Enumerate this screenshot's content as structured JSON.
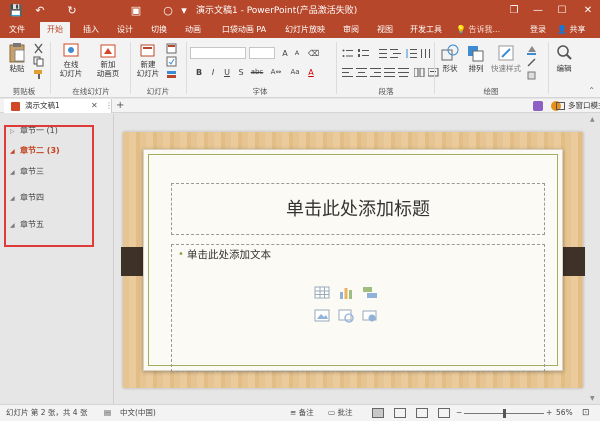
{
  "window": {
    "title": "演示文稿1 - PowerPoint(产品激活失败)",
    "controls": {
      "restore": "❐",
      "minimize": "—",
      "maximize": "☐",
      "close": "✕"
    }
  },
  "quick_access": {
    "save": "💾",
    "undo": "↶",
    "redo": "↻",
    "slideshow": "▣",
    "shape": "○",
    "customize": "▾"
  },
  "tabs": [
    "文件",
    "开始",
    "插入",
    "设计",
    "切换",
    "动画",
    "口袋动画 PA",
    "幻灯片放映",
    "审阅",
    "视图",
    "开发工具"
  ],
  "active_tab": "开始",
  "tell_me": "告诉我...",
  "login": "登录",
  "share": "共享",
  "ribbon": {
    "paste": "粘贴",
    "online_slides": "在线\n幻灯片",
    "new_animation_page": "新加\n动画页",
    "new_slide": "新建\n幻灯片",
    "shape": "形状",
    "arrange": "排列",
    "quick_styles": "快速样式",
    "edit": "编辑",
    "groups": {
      "clipboard": "剪贴板",
      "online_slides": "在线幻灯片",
      "slides": "幻灯片",
      "font": "字体",
      "paragraph": "段落",
      "drawing": "绘图"
    },
    "font_buttons": [
      "B",
      "I",
      "U",
      "S",
      "abc",
      "A⇔",
      "Aa",
      "A",
      "A"
    ],
    "collapse": "⌃"
  },
  "doc_tab": {
    "name": "演示文稿1",
    "close": "✕",
    "more": "⋮",
    "new": "+"
  },
  "multi_window": "多窗口模式",
  "sections": [
    {
      "name": "章节一",
      "count": "(1)",
      "expanded": false
    },
    {
      "name": "章节二",
      "count": "(3)",
      "expanded": true
    },
    {
      "name": "章节三",
      "count": "",
      "expanded": true
    },
    {
      "name": "章节四",
      "count": "",
      "expanded": true
    },
    {
      "name": "章节五",
      "count": "",
      "expanded": true
    }
  ],
  "active_section": "章节二",
  "slide": {
    "title_placeholder": "单击此处添加标题",
    "body_placeholder": "单击此处添加文本",
    "bullet": "•"
  },
  "status": {
    "slide_info": "幻灯片 第 2 张，共 4 张",
    "language": "中文(中国)",
    "notes": "备注",
    "comments": "批注",
    "zoom_minus": "−",
    "zoom_plus": "+",
    "zoom": "56%",
    "zoom_level": 0.56
  },
  "colors": {
    "accent": "#b7472a",
    "section_active": "#c2401d",
    "highlight_box": "#e03b3b",
    "wood": "#e7c592",
    "frame": "#9fb061"
  }
}
